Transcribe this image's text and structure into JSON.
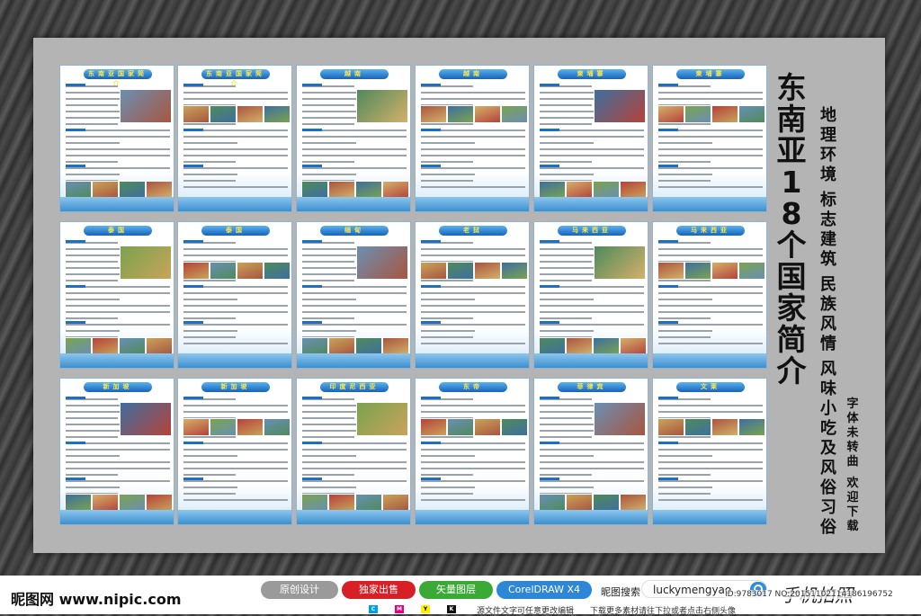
{
  "poster": {
    "title": "东南亚18个国家简介",
    "subtitle_cols": [
      "地理环境",
      "标志建筑",
      "民族风情",
      "风味小吃及风俗习俗"
    ],
    "note_cols": [
      "字体未转曲",
      "欢迎下载"
    ]
  },
  "panels": [
    {
      "header": "东南亚国家简介"
    },
    {
      "header": "东南亚国家简介"
    },
    {
      "header": "越南"
    },
    {
      "header": "越南"
    },
    {
      "header": "柬埔寨"
    },
    {
      "header": "柬埔寨"
    },
    {
      "header": "泰国"
    },
    {
      "header": "泰国"
    },
    {
      "header": "缅甸"
    },
    {
      "header": "老挝"
    },
    {
      "header": "马来西亚"
    },
    {
      "header": "马来西亚"
    },
    {
      "header": "新加坡"
    },
    {
      "header": "新加坡"
    },
    {
      "header": "印度尼西亚"
    },
    {
      "header": "东帝"
    },
    {
      "header": "菲律宾"
    },
    {
      "header": "文莱"
    }
  ],
  "footer": {
    "site_logo": "昵图网 www.nipic.com",
    "buttons": [
      {
        "label": "原创设计",
        "color": "#9a9a9a"
      },
      {
        "label": "独家出售",
        "color": "#d81f26"
      },
      {
        "label": "矢量图层",
        "color": "#3aa935"
      },
      {
        "label": "CorelDRAW X4",
        "color": "#2d86d6"
      }
    ],
    "search_label": "昵图搜索",
    "search_value": "luckymengyao",
    "cmyk": [
      "C",
      "M",
      "Y",
      "K"
    ],
    "edit_note": "源文件文字可任意更改编辑",
    "download_note": "下载更多素材请往下拉或者点击右侧头像",
    "id_text": "ID:9783017 NO:20151102114186196752",
    "signature": "手机拍照"
  }
}
